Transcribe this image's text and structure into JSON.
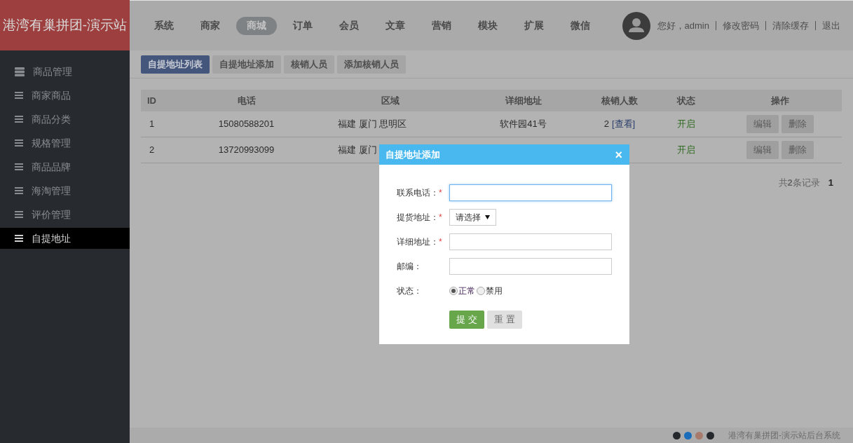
{
  "logo": "港湾有巢拼团-演示站",
  "nav": [
    {
      "label": "系统",
      "selected": false
    },
    {
      "label": "商家",
      "selected": false
    },
    {
      "label": "商城",
      "selected": true
    },
    {
      "label": "订单",
      "selected": false
    },
    {
      "label": "会员",
      "selected": false
    },
    {
      "label": "文章",
      "selected": false
    },
    {
      "label": "营销",
      "selected": false
    },
    {
      "label": "模块",
      "selected": false
    },
    {
      "label": "扩展",
      "selected": false
    },
    {
      "label": "微信",
      "selected": false
    }
  ],
  "user": {
    "greeting": "您好，admin",
    "links": [
      "修改密码",
      "清除缓存",
      "退出"
    ]
  },
  "subtabs": [
    {
      "label": "自提地址列表",
      "selected": true
    },
    {
      "label": "自提地址添加",
      "selected": false
    },
    {
      "label": "核销人员",
      "selected": false
    },
    {
      "label": "添加核销人员",
      "selected": false
    }
  ],
  "sidebar": [
    {
      "label": "商品管理",
      "kind": "stack",
      "selected": false
    },
    {
      "label": "商家商品",
      "kind": "list",
      "selected": false
    },
    {
      "label": "商品分类",
      "kind": "list",
      "selected": false
    },
    {
      "label": "规格管理",
      "kind": "list",
      "selected": false
    },
    {
      "label": "商品品牌",
      "kind": "list",
      "selected": false
    },
    {
      "label": "海淘管理",
      "kind": "list",
      "selected": false
    },
    {
      "label": "评价管理",
      "kind": "list",
      "selected": false
    },
    {
      "label": "自提地址",
      "kind": "list",
      "selected": true
    }
  ],
  "table": {
    "columns": [
      "ID",
      "电话",
      "区域",
      "详细地址",
      "核销人数",
      "状态",
      "操作"
    ],
    "rows": [
      {
        "id": "1",
        "phone": "15080588201",
        "region": "福建 厦门 思明区",
        "detail": "软件园41号",
        "count": "2",
        "view": "[查看]",
        "status": "开启",
        "actions": [
          "编辑",
          "删除"
        ]
      },
      {
        "id": "2",
        "phone": "13720993099",
        "region": "福建 厦门",
        "status": "开启",
        "actions": [
          "编辑",
          "删除"
        ]
      }
    ]
  },
  "pagination": {
    "total": "共**2**条记录",
    "page": "1"
  },
  "modal": {
    "title": "自提地址添加",
    "close": "×",
    "fields": [
      {
        "kind": "text",
        "label": "联系电话：",
        "required_mark": "*",
        "focused": true
      },
      {
        "kind": "select",
        "label": "提货地址：",
        "required_mark": "*",
        "value": "请选择"
      },
      {
        "kind": "text",
        "label": "详细地址：",
        "required_mark": "*",
        "focused": false
      },
      {
        "kind": "text",
        "label": "邮编：",
        "focused": false
      },
      {
        "kind": "radio",
        "label": "状态：",
        "options": [
          {
            "label": "正常",
            "selected": true
          },
          {
            "label": "禁用",
            "selected": false
          }
        ]
      }
    ],
    "submit": "提 交",
    "reset": "重 置"
  },
  "footer": {
    "dots": [
      {
        "color": "#25292e"
      },
      {
        "color": "#1a6dbb"
      },
      {
        "color": "#a87a6c"
      },
      {
        "color": "#25292e"
      }
    ],
    "text": "港湾有巢拼团-演示站后台系统"
  }
}
